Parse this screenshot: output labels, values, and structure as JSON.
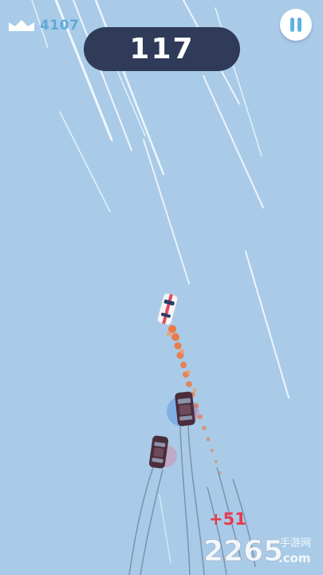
{
  "hud": {
    "best_score": "4107",
    "score": "117",
    "bonus_popup": "+51"
  },
  "icons": {
    "crown": "crown-icon",
    "pause": "pause-icon"
  },
  "watermark": {
    "text": "2265.com",
    "text_cn": "手游网"
  },
  "colors": {
    "sky": "#a9cbe8",
    "score_pill": "#2f3b58",
    "best_score_text": "#5fa9d6",
    "bonus_text": "#e63a4f",
    "flame": "#f0733a"
  }
}
